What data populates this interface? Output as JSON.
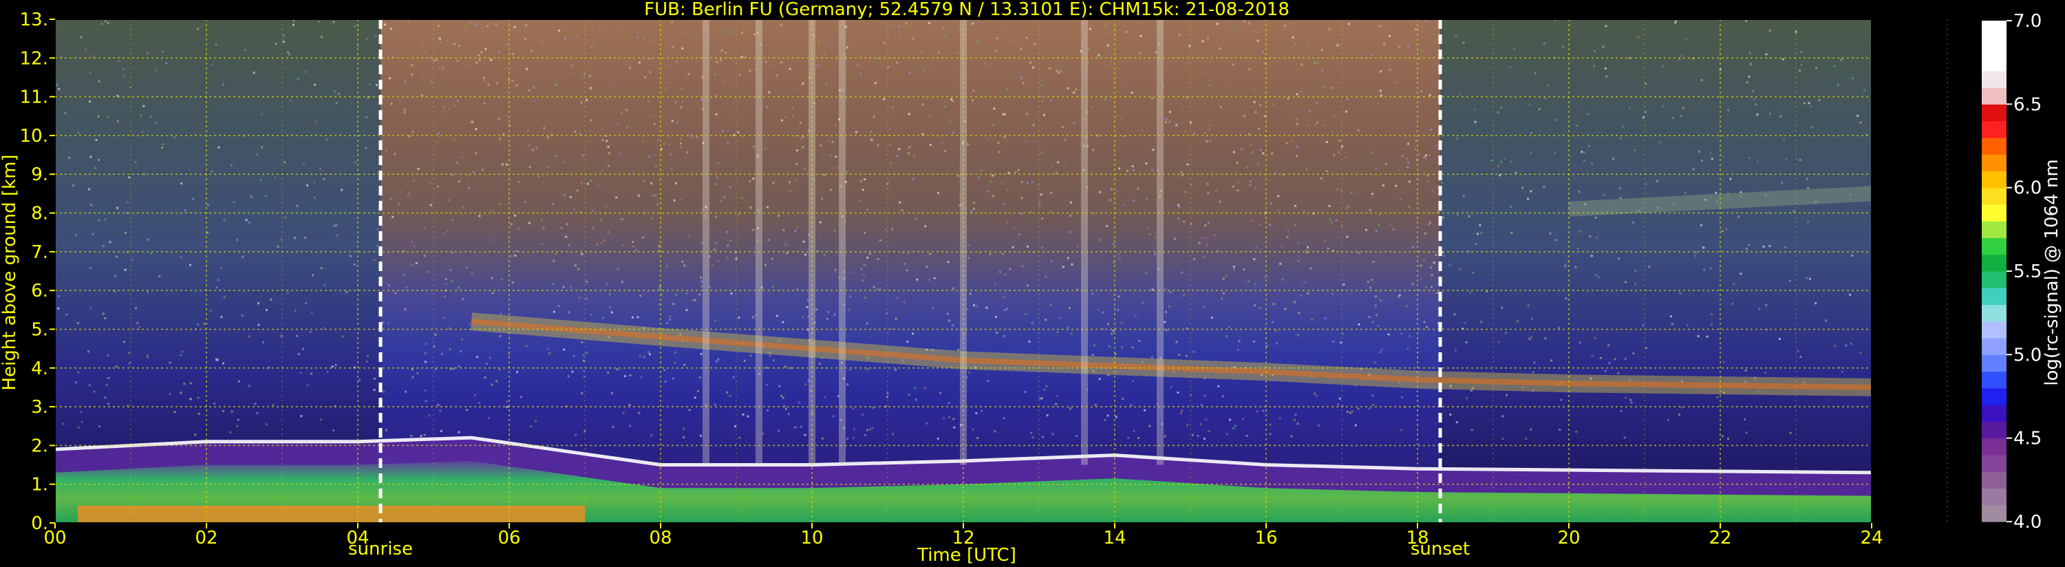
{
  "chart_data": {
    "type": "heatmap",
    "title": "FUB: Berlin FU (Germany; 52.4579 N / 13.3101 E):    CHM15k: 21-08-2018",
    "xlabel": "Time [UTC]",
    "ylabel": "Height above ground [km]",
    "xlim": [
      0,
      24
    ],
    "ylim": [
      0,
      13
    ],
    "x_ticks": [
      "00",
      "02",
      "04",
      "06",
      "08",
      "10",
      "12",
      "14",
      "16",
      "18",
      "20",
      "22",
      "24"
    ],
    "y_ticks": [
      "0.",
      "1.",
      "2.",
      "3.",
      "4.",
      "5.",
      "6.",
      "7.",
      "8.",
      "9.",
      "10.",
      "11.",
      "12.",
      "13."
    ],
    "grid": true,
    "colorbar": {
      "label": "log(rc-signal) @ 1064 nm",
      "range": [
        4.0,
        7.0
      ],
      "ticks": [
        "4.0",
        "4.5",
        "5.0",
        "5.5",
        "6.0",
        "6.5",
        "7.0"
      ],
      "colors": [
        "#a08ca0",
        "#9a7aa0",
        "#8f5f9a",
        "#84449a",
        "#7a2e96",
        "#5a1aa0",
        "#3a10c0",
        "#2020f0",
        "#3050ff",
        "#6080ff",
        "#8fa0ff",
        "#b0c0ff",
        "#90e0e0",
        "#40d0c0",
        "#20c070",
        "#10b040",
        "#30d040",
        "#a0e840",
        "#ffff30",
        "#ffe020",
        "#ffc000",
        "#ff9000",
        "#ff6000",
        "#ff2020",
        "#e01010",
        "#f0c0c0",
        "#f0e8e8",
        "#ffffff",
        "#ffffff",
        "#ffffff"
      ]
    },
    "annotations": [
      {
        "label": "sunrise",
        "x": 4.3
      },
      {
        "label": "sunset",
        "x": 18.3
      }
    ],
    "features": {
      "boundary_layer_top_km": [
        {
          "x": 0,
          "y": 1.9
        },
        {
          "x": 2,
          "y": 2.1
        },
        {
          "x": 4,
          "y": 2.1
        },
        {
          "x": 5.5,
          "y": 2.2
        },
        {
          "x": 8,
          "y": 1.5
        },
        {
          "x": 10,
          "y": 1.5
        },
        {
          "x": 12,
          "y": 1.6
        },
        {
          "x": 14,
          "y": 1.75
        },
        {
          "x": 16,
          "y": 1.5
        },
        {
          "x": 18,
          "y": 1.4
        },
        {
          "x": 24,
          "y": 1.3
        }
      ],
      "aerosol_layer_km": [
        {
          "x": 5.5,
          "y": 5.2
        },
        {
          "x": 8,
          "y": 4.8
        },
        {
          "x": 12,
          "y": 4.2
        },
        {
          "x": 16,
          "y": 3.9
        },
        {
          "x": 18,
          "y": 3.7
        },
        {
          "x": 20,
          "y": 3.6
        },
        {
          "x": 24,
          "y": 3.5
        }
      ],
      "upper_layer_km": [
        {
          "x": 20,
          "y": 8.1
        },
        {
          "x": 22,
          "y": 8.3
        },
        {
          "x": 24,
          "y": 8.5
        }
      ]
    }
  },
  "colors": {
    "background": "#000000",
    "text": "#ffff00",
    "grid": "#d8d800",
    "marker": "#ffffff"
  }
}
